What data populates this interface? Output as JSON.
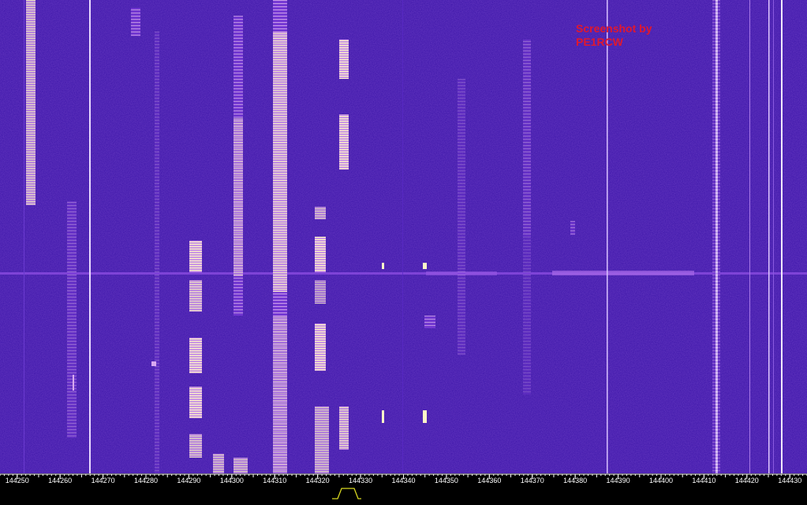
{
  "waterfall": {
    "watermark_line1": "Screenshot by",
    "watermark_line2": "PE1RCW",
    "colors": {
      "background": "#3b14a8",
      "signal_low": "#7a3bd8",
      "signal_mid": "#c58be8",
      "signal_high": "#fff4c8",
      "watermark": "#e0182f"
    }
  },
  "frequency_scale": {
    "ticks": [
      "144250",
      "144260",
      "144270",
      "144280",
      "144290",
      "144300",
      "144310",
      "144320",
      "144330",
      "144340",
      "144350",
      "144360",
      "144370",
      "144380",
      "144390",
      "144400",
      "144410",
      "144420",
      "144430"
    ],
    "range_khz": [
      144246,
      144434
    ],
    "colors": {
      "tick": "#ffffff",
      "passband_marker": "#d8d820"
    }
  },
  "passband_marker": {
    "icon": "passband-filter-icon"
  }
}
